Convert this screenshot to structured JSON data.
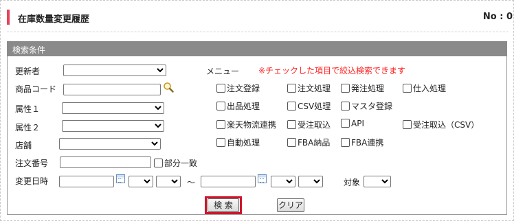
{
  "header": {
    "title": "在庫数量変更履歴",
    "no_label": "No : 0"
  },
  "panel": {
    "title": "検索条件"
  },
  "fields": {
    "updater": "更新者",
    "product_code": "商品コード",
    "attr1": "属性１",
    "attr2": "属性２",
    "store": "店舗",
    "order_no": "注文番号",
    "partial_match": "部分一致",
    "changed_at": "変更日時",
    "tilde": "～",
    "target": "対象"
  },
  "menu": {
    "label": "メニュー",
    "note": "※チェックした項目で絞込検索できます",
    "items": [
      "注文登録",
      "注文処理",
      "発注処理",
      "仕入処理",
      "出品処理",
      "CSV処理",
      "マスタ登録",
      "楽天物流連携",
      "受注取込",
      "API",
      "受注取込（CSV）",
      "自動処理",
      "FBA納品",
      "FBA連携"
    ]
  },
  "buttons": {
    "search": "検 索",
    "clear": "クリア"
  },
  "colors": {
    "accent": "#e4455b",
    "highlight": "#d0142a",
    "note": "#ff2222",
    "panel_head": "#8a8a8a"
  }
}
